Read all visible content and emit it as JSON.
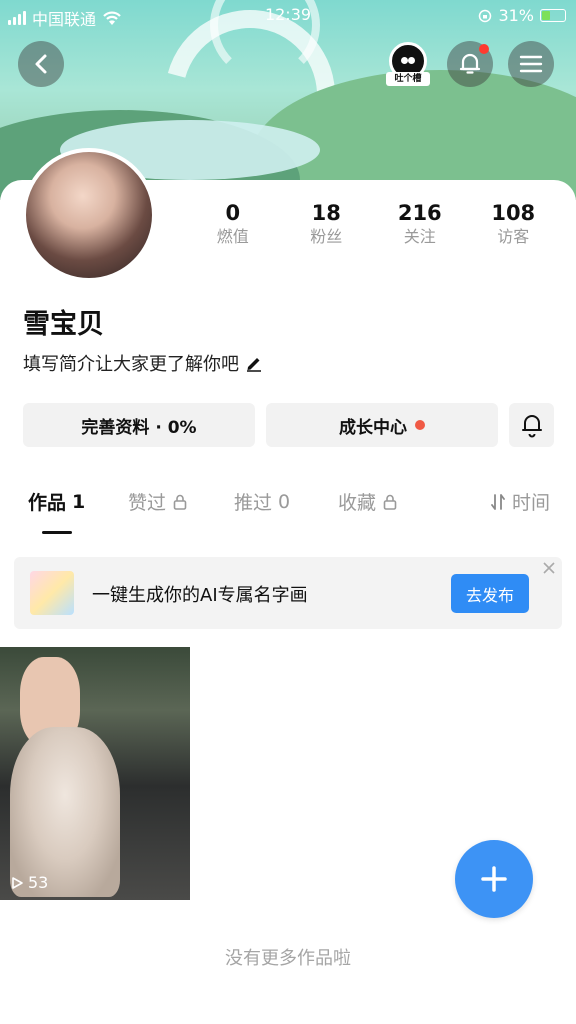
{
  "status_bar": {
    "carrier": "中国联通",
    "time": "12:39",
    "battery": "31%"
  },
  "header": {
    "mascot_label": "吐个槽"
  },
  "profile": {
    "name": "雪宝贝",
    "bio": "填写简介让大家更了解你吧",
    "stats": [
      {
        "value": "0",
        "label": "燃值"
      },
      {
        "value": "18",
        "label": "粉丝"
      },
      {
        "value": "216",
        "label": "关注"
      },
      {
        "value": "108",
        "label": "访客"
      }
    ]
  },
  "actions": {
    "complete_profile": "完善资料 · 0%",
    "growth_center": "成长中心"
  },
  "tabs": [
    {
      "label": "作品",
      "count": "1"
    },
    {
      "label": "赞过",
      "count": ""
    },
    {
      "label": "推过",
      "count": "0"
    },
    {
      "label": "收藏",
      "count": ""
    }
  ],
  "sort": {
    "label": "时间"
  },
  "promo": {
    "text": "一键生成你的AI专属名字画",
    "button": "去发布"
  },
  "works": [
    {
      "plays": "53"
    }
  ],
  "footer_note": "没有更多作品啦",
  "colors": {
    "accent_blue": "#2f8cf5",
    "red_dot": "#f05a45"
  }
}
